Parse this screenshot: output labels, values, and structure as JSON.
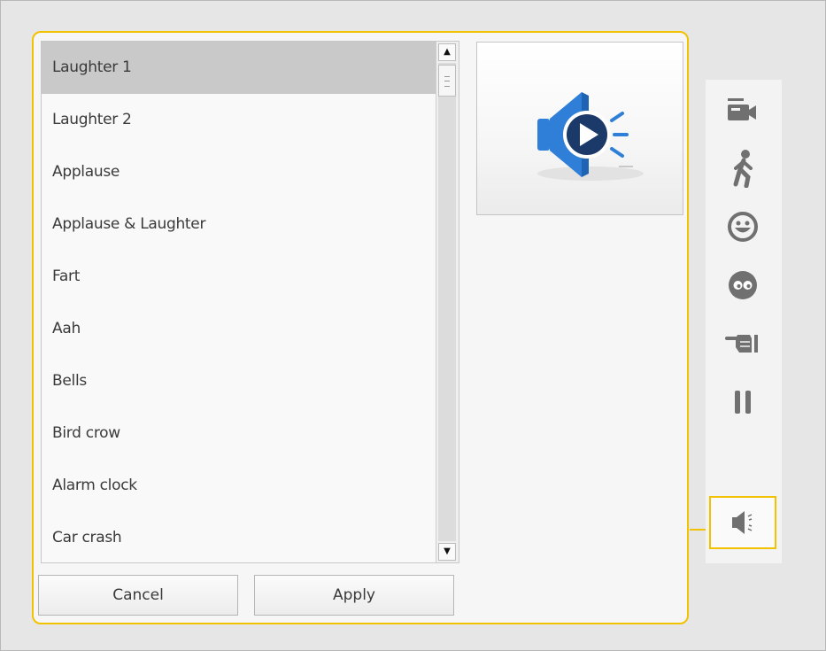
{
  "sound_list": {
    "items": [
      {
        "label": "Laughter 1",
        "selected": true
      },
      {
        "label": "Laughter 2",
        "selected": false
      },
      {
        "label": "Applause",
        "selected": false
      },
      {
        "label": "Applause & Laughter",
        "selected": false
      },
      {
        "label": "Fart",
        "selected": false
      },
      {
        "label": "Aah",
        "selected": false
      },
      {
        "label": "Bells",
        "selected": false
      },
      {
        "label": "Bird crow",
        "selected": false
      },
      {
        "label": "Alarm clock",
        "selected": false
      },
      {
        "label": "Car crash",
        "selected": false
      }
    ]
  },
  "buttons": {
    "cancel": "Cancel",
    "apply": "Apply"
  },
  "preview": {
    "icon": "sound-play-icon"
  },
  "toolbar": {
    "tools": [
      {
        "name": "camera-icon",
        "active": false
      },
      {
        "name": "walking-person-icon",
        "active": false
      },
      {
        "name": "smiley-face-icon",
        "active": false
      },
      {
        "name": "eyes-face-icon",
        "active": false
      },
      {
        "name": "pointing-hand-icon",
        "active": false
      },
      {
        "name": "pause-icon",
        "active": false
      },
      {
        "name": "speaker-icon",
        "active": true
      }
    ]
  },
  "colors": {
    "accent": "#f2c200",
    "selected_row": "#c9c9c9",
    "icon_gray": "#707070",
    "speaker_blue": "#2f7fd8",
    "play_dark": "#1b3a6a"
  }
}
